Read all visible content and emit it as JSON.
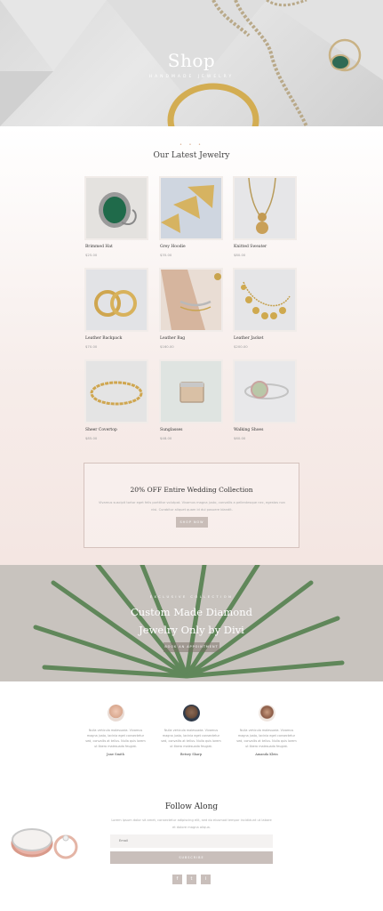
{
  "hero": {
    "title": "Shop",
    "subtitle": "HANDMADE JEWELRY"
  },
  "latest": {
    "divider": "• • •",
    "title": "Our Latest Jewelry",
    "products": [
      {
        "name": "Brimmed Hat",
        "price": "$25.00"
      },
      {
        "name": "Grey Hoodie",
        "price": "$35.00"
      },
      {
        "name": "Knitted Sweater",
        "price": "$80.00"
      },
      {
        "name": "Leather Backpack",
        "price": "$70.00"
      },
      {
        "name": "Leather Bag",
        "price": "$160.00"
      },
      {
        "name": "Leather Jacket",
        "price": "$200.00"
      },
      {
        "name": "Sheer Covertop",
        "price": "$85.00"
      },
      {
        "name": "Sunglasses",
        "price": "$48.00"
      },
      {
        "name": "Walking Shoes",
        "price": "$60.00"
      }
    ]
  },
  "promo": {
    "title": "20% OFF Entire Wedding Collection",
    "text": "Vivamus suscipit tortor eget felis porttitor volutpat. Vivamus magna justo, convallis a pellentesque nec, egestas non nisi. Curabitur aliquet quam id dui posuere blandit.",
    "button": "SHOP NOW"
  },
  "exclusive": {
    "kicker": "EXCLUSIVE COLLECTION",
    "line1": "Custom Made Diamond",
    "line2": "Jewelry Only by Divi",
    "button": "BOOK AN APPOINTMENT"
  },
  "testimonials": [
    {
      "quote": "Nulla vehicula malesuada. Vivamus magna justo, lacinia eget consectetur sed, convallis at tellus. Nulla quis lorem ut libero malesuada feugiat.",
      "name": "Jane Smith"
    },
    {
      "quote": "Nulla vehicula malesuada. Vivamus magna justo, lacinia eget consectetur sed, convallis at tellus. Nulla quis lorem ut libero malesuada feugiat.",
      "name": "Betsey Sharp"
    },
    {
      "quote": "Nulla vehicula malesuada. Vivamus magna justo, lacinia eget consectetur sed, convallis at tellus. Nulla quis lorem ut libero malesuada feugiat.",
      "name": "Amanda Klein"
    }
  ],
  "follow": {
    "title": "Follow Along",
    "text": "Lorem ipsum dolor sit amet, consectetur adipiscing elit, sed do eiusmod tempor incididunt ut labore et dolore magna aliqua.",
    "email_placeholder": "Email",
    "subscribe": "SUBSCRIBE",
    "social": [
      "f",
      "t",
      "i"
    ]
  },
  "colors": {
    "accent": "#c9bdb8",
    "promo_border": "#d5c2bd",
    "gold": "#c9a44e"
  }
}
